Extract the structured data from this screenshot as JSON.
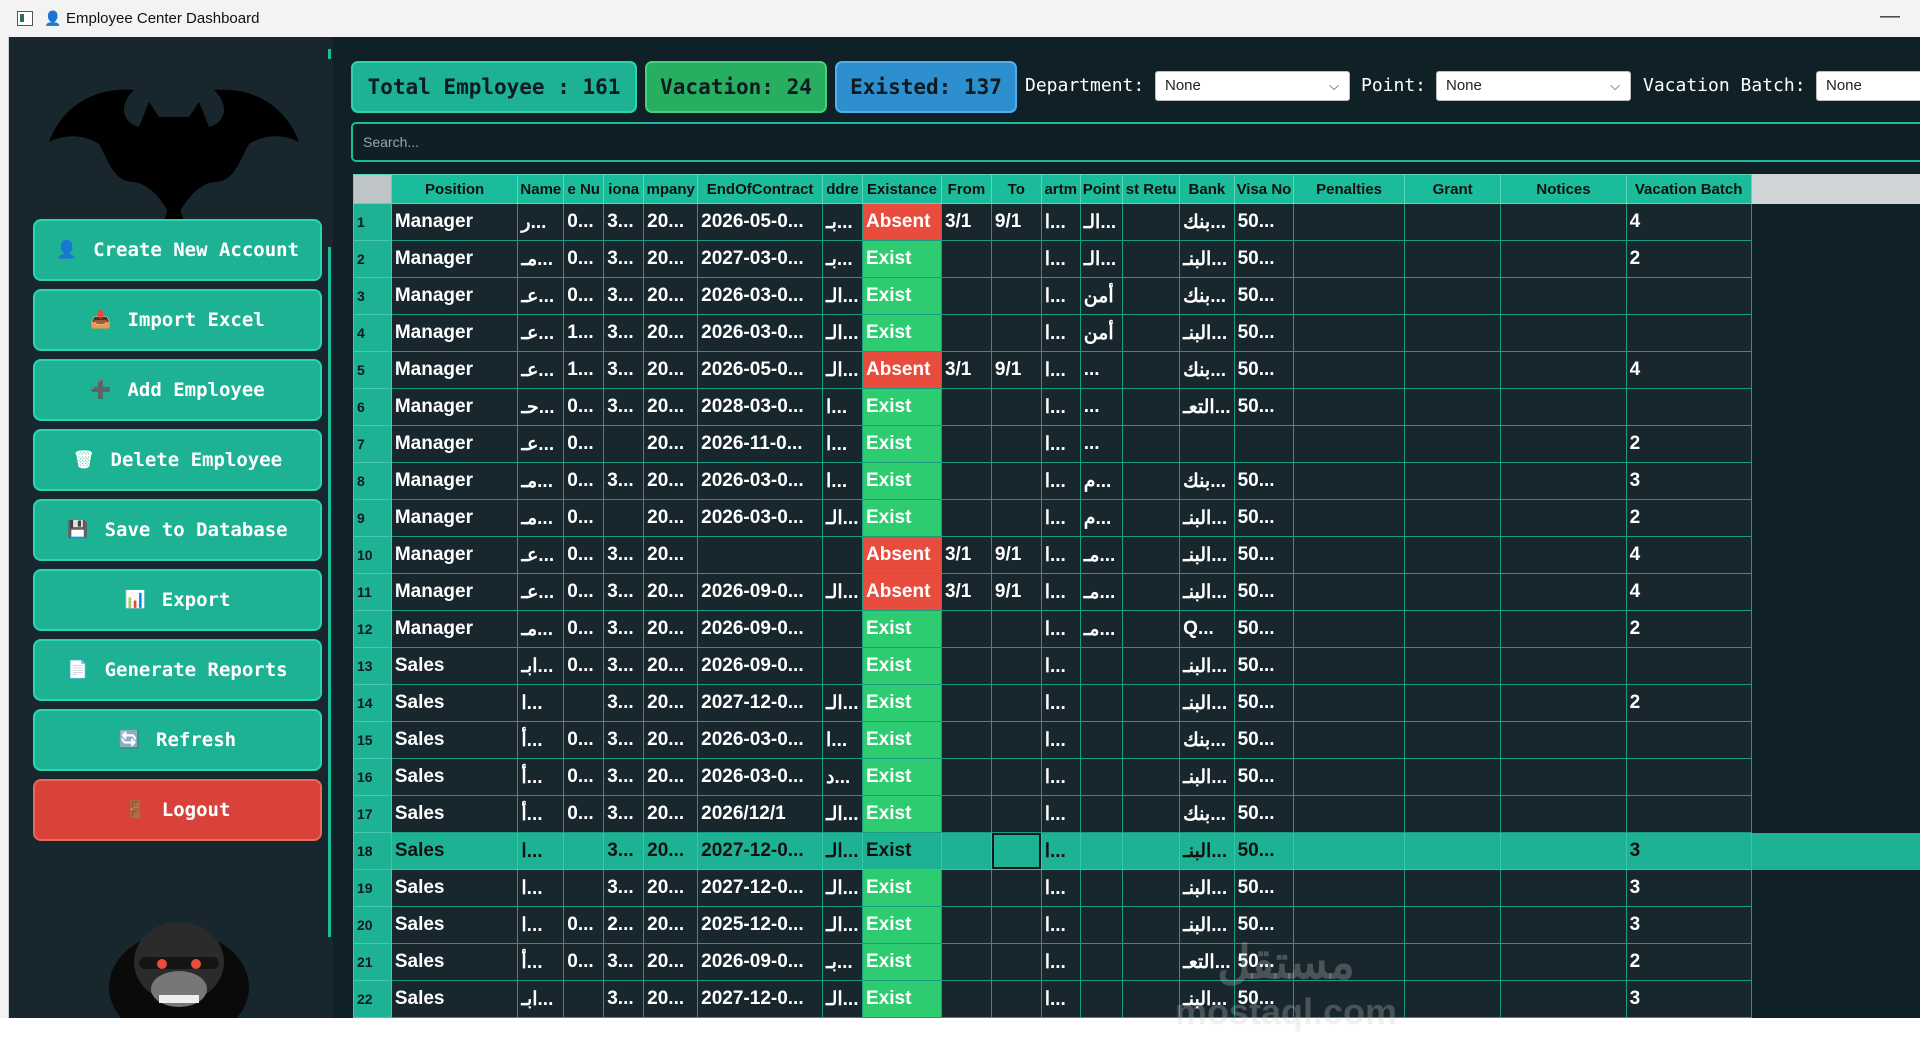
{
  "window": {
    "title": "Employee Center Dashboard",
    "minimize": "—"
  },
  "sidebar": {
    "buttons": [
      {
        "id": "create",
        "icon": "👤",
        "label": "Create New Account"
      },
      {
        "id": "import",
        "icon": "📥",
        "label": "Import Excel"
      },
      {
        "id": "add",
        "icon": "➕",
        "label": "Add Employee"
      },
      {
        "id": "delete",
        "icon": "🗑",
        "label": "Delete Employee"
      },
      {
        "id": "save",
        "icon": "💾",
        "label": "Save to Database"
      },
      {
        "id": "export",
        "icon": "📊",
        "label": "Export"
      },
      {
        "id": "reports",
        "icon": "📄",
        "label": "Generate Reports"
      },
      {
        "id": "refresh",
        "icon": "🔄",
        "label": "Refresh"
      },
      {
        "id": "logout",
        "icon": "🚪",
        "label": "Logout"
      }
    ]
  },
  "stats": {
    "total": "Total Employee : 161",
    "vacation": "Vacation: 24",
    "existed": "Existed: 137"
  },
  "filters": {
    "department_label": "Department:",
    "department_value": "None",
    "point_label": "Point:",
    "point_value": "None",
    "batch_label": "Vacation Batch:",
    "batch_value": "None"
  },
  "search": {
    "placeholder": "Search..."
  },
  "table": {
    "columns": [
      "Position",
      "Name",
      "e Nu",
      "iona",
      "mpany",
      "EndOfContract",
      "ddre",
      "Existance",
      "From",
      "To",
      "artm",
      "Point",
      "st Retu",
      "Bank",
      "Visa No",
      "Penalties",
      "Grant",
      "Notices",
      "Vacation Batch"
    ],
    "rows": [
      [
        "1",
        "Manager",
        "ر...",
        "0...",
        "3...",
        "20...",
        "2026-05-0...",
        "بـ...",
        "Absent",
        "3/1",
        "9/1",
        "ا...",
        "الـ...",
        "",
        "بنك...",
        "50...",
        "",
        "",
        "",
        "4"
      ],
      [
        "2",
        "Manager",
        "مـ...",
        "0...",
        "3...",
        "20...",
        "2027-03-0...",
        "بـ...",
        "Exist",
        "",
        "",
        "ا...",
        "الـ...",
        "",
        "البنـ...",
        "50...",
        "",
        "",
        "",
        "2"
      ],
      [
        "3",
        "Manager",
        "عـ...",
        "0...",
        "3...",
        "20...",
        "2026-03-0...",
        "الـ...",
        "Exist",
        "",
        "",
        "ا...",
        "أمن",
        "",
        "بنك...",
        "50...",
        "",
        "",
        "",
        ""
      ],
      [
        "4",
        "Manager",
        "عـ...",
        "1...",
        "3...",
        "20...",
        "2026-03-0...",
        "الـ...",
        "Exist",
        "",
        "",
        "ا...",
        "أمن",
        "",
        "البنـ...",
        "50...",
        "",
        "",
        "",
        ""
      ],
      [
        "5",
        "Manager",
        "عـ...",
        "1...",
        "3...",
        "20...",
        "2026-05-0...",
        "الـ...",
        "Absent",
        "3/1",
        "9/1",
        "ا...",
        "...",
        "",
        "بنك...",
        "50...",
        "",
        "",
        "",
        "4"
      ],
      [
        "6",
        "Manager",
        "حـ...",
        "0...",
        "3...",
        "20...",
        "2028-03-0...",
        "ا...",
        "Exist",
        "",
        "",
        "ا...",
        "...",
        "",
        "التعـ...",
        "50...",
        "",
        "",
        "",
        ""
      ],
      [
        "7",
        "Manager",
        "عـ...",
        "0...",
        "",
        "20...",
        "2026-11-0...",
        "ا...",
        "Exist",
        "",
        "",
        "ا...",
        "...",
        "",
        "",
        "",
        "",
        "",
        "",
        "2"
      ],
      [
        "8",
        "Manager",
        "مـ...",
        "0...",
        "3...",
        "20...",
        "2026-03-0...",
        "ا...",
        "Exist",
        "",
        "",
        "ا...",
        "م...",
        "",
        "بنك...",
        "50...",
        "",
        "",
        "",
        "3"
      ],
      [
        "9",
        "Manager",
        "مـ...",
        "0...",
        "",
        "20...",
        "2026-03-0...",
        "الـ...",
        "Exist",
        "",
        "",
        "ا...",
        "م...",
        "",
        "البنـ...",
        "50...",
        "",
        "",
        "",
        "2"
      ],
      [
        "10",
        "Manager",
        "عـ...",
        "0...",
        "3...",
        "20...",
        "",
        "",
        "Absent",
        "3/1",
        "9/1",
        "ا...",
        "مـ...",
        "",
        "البنـ...",
        "50...",
        "",
        "",
        "",
        "4"
      ],
      [
        "11",
        "Manager",
        "عـ...",
        "0...",
        "3...",
        "20...",
        "2026-09-0...",
        "الـ...",
        "Absent",
        "3/1",
        "9/1",
        "ا...",
        "مـ...",
        "",
        "البنـ...",
        "50...",
        "",
        "",
        "",
        "4"
      ],
      [
        "12",
        "Manager",
        "مـ...",
        "0...",
        "3...",
        "20...",
        "2026-09-0...",
        "",
        "Exist",
        "",
        "",
        "ا...",
        "مـ...",
        "",
        "Q...",
        "50...",
        "",
        "",
        "",
        "2"
      ],
      [
        "13",
        "Sales",
        "ابـ...",
        "0...",
        "3...",
        "20...",
        "2026-09-0...",
        "",
        "Exist",
        "",
        "",
        "ا...",
        "",
        "",
        "البنـ...",
        "50...",
        "",
        "",
        "",
        ""
      ],
      [
        "14",
        "Sales",
        "ا...",
        "",
        "3...",
        "20...",
        "2027-12-0...",
        "الـ...",
        "Exist",
        "",
        "",
        "ا...",
        "",
        "",
        "البنـ...",
        "50...",
        "",
        "",
        "",
        "2"
      ],
      [
        "15",
        "Sales",
        "أ...",
        "0...",
        "3...",
        "20...",
        "2026-03-0...",
        "ا...",
        "Exist",
        "",
        "",
        "ا...",
        "",
        "",
        "بنك...",
        "50...",
        "",
        "",
        "",
        ""
      ],
      [
        "16",
        "Sales",
        "أ...",
        "0...",
        "3...",
        "20...",
        "2026-03-0...",
        "د...",
        "Exist",
        "",
        "",
        "ا...",
        "",
        "",
        "البنـ...",
        "50...",
        "",
        "",
        "",
        ""
      ],
      [
        "17",
        "Sales",
        "أ...",
        "0...",
        "3...",
        "20...",
        "2026/12/1",
        "الـ...",
        "Exist",
        "",
        "",
        "ا...",
        "",
        "",
        "بنك...",
        "50...",
        "",
        "",
        "",
        ""
      ],
      [
        "18",
        "Sales",
        "ا...",
        "",
        "3...",
        "20...",
        "2027-12-0...",
        "الـ...",
        "Exist",
        "",
        "",
        "ا...",
        "",
        "",
        "البنـ...",
        "50...",
        "",
        "",
        "",
        "3"
      ],
      [
        "19",
        "Sales",
        "ا...",
        "",
        "3...",
        "20...",
        "2027-12-0...",
        "الـ...",
        "Exist",
        "",
        "",
        "ا...",
        "",
        "",
        "البنـ...",
        "50...",
        "",
        "",
        "",
        "3"
      ],
      [
        "20",
        "Sales",
        "ا...",
        "0...",
        "2...",
        "20...",
        "2025-12-0...",
        "الـ...",
        "Exist",
        "",
        "",
        "ا...",
        "",
        "",
        "البنـ...",
        "50...",
        "",
        "",
        "",
        "3"
      ],
      [
        "21",
        "Sales",
        "أ...",
        "0...",
        "3...",
        "20...",
        "2026-09-0...",
        "بـ...",
        "Exist",
        "",
        "",
        "ا...",
        "",
        "",
        "التعـ...",
        "50...",
        "",
        "",
        "",
        "2"
      ],
      [
        "22",
        "Sales",
        "ابـ...",
        "",
        "3...",
        "20...",
        "2027-12-0...",
        "الـ...",
        "Exist",
        "",
        "",
        "ا...",
        "",
        "",
        "البنـ...",
        "50...",
        "",
        "",
        "",
        "3"
      ]
    ],
    "selected_row": 18
  },
  "watermark": {
    "arabic": "مستقل",
    "latin": "mostaql.com"
  },
  "colors": {
    "accent": "#1abc9c",
    "exist": "#2ecc71",
    "absent": "#e74c3c",
    "background": "#102027",
    "sidebar": "#18262d"
  }
}
